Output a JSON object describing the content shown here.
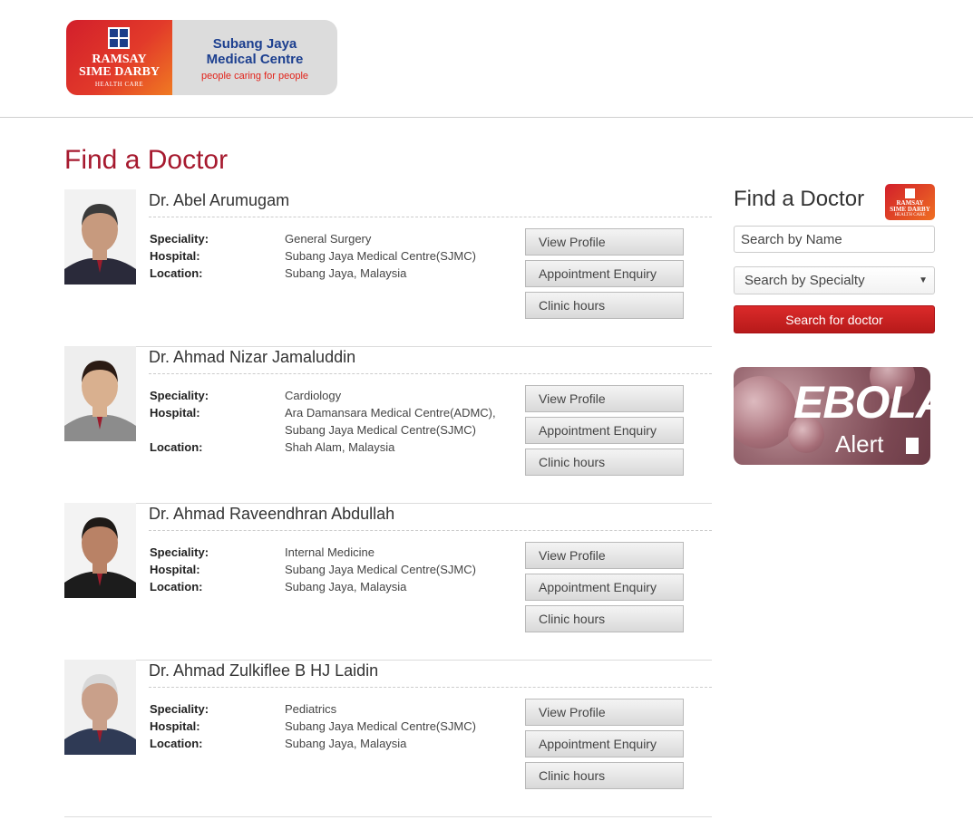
{
  "brand": {
    "parent_line1": "RAMSAY",
    "parent_line2": "SIME DARBY",
    "parent_line3": "HEALTH CARE",
    "hospital_line1": "Subang Jaya",
    "hospital_line2": "Medical Centre",
    "tagline": "people caring for people"
  },
  "page_title": "Find a Doctor",
  "labels": {
    "speciality": "Speciality:",
    "hospital": "Hospital:",
    "location": "Location:"
  },
  "buttons": {
    "view_profile": "View Profile",
    "appointment": "Appointment Enquiry",
    "clinic_hours": "Clinic hours"
  },
  "doctors": [
    {
      "name": "Dr. Abel Arumugam",
      "speciality": "General Surgery",
      "hospitals": [
        "Subang Jaya Medical Centre(SJMC)"
      ],
      "location": "Subang Jaya, Malaysia"
    },
    {
      "name": "Dr. Ahmad Nizar Jamaluddin",
      "speciality": "Cardiology",
      "hospitals": [
        "Ara Damansara Medical Centre(ADMC),",
        "Subang Jaya Medical Centre(SJMC)"
      ],
      "location": "Shah Alam, Malaysia"
    },
    {
      "name": "Dr. Ahmad Raveendhran Abdullah",
      "speciality": "Internal Medicine",
      "hospitals": [
        "Subang Jaya Medical Centre(SJMC)"
      ],
      "location": "Subang Jaya, Malaysia"
    },
    {
      "name": "Dr. Ahmad Zulkiflee B HJ Laidin",
      "speciality": "Pediatrics",
      "hospitals": [
        "Subang Jaya Medical Centre(SJMC)"
      ],
      "location": "Subang Jaya, Malaysia"
    }
  ],
  "sidebar": {
    "title": "Find a Doctor",
    "logo_line1": "RAMSAY",
    "logo_line2": "SIME DARBY",
    "logo_line3": "HEALTH CARE",
    "name_placeholder": "Search by Name",
    "specialty_selected": "Search by Specialty",
    "search_button": "Search for doctor",
    "banner_word1": "EBOLA",
    "banner_word2": "Alert"
  }
}
